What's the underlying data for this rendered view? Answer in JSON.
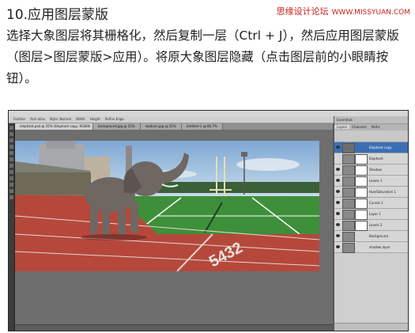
{
  "article": {
    "heading": "10.应用图层蒙版",
    "watermark": "思缘设计论坛",
    "watermark_url": "WWW.MISSYUAN.COM",
    "instructions": "选择大象图层将其栅格化，然后复制一层（Ctrl + J），然后应用图层蒙版（图层>图层蒙版>应用）。将原大象图层隐藏（点击图层前的小眼睛按钮）。"
  },
  "photoshop": {
    "options_bar": [
      "Feather",
      "Anti-alias",
      "Style: Normal",
      "Width",
      "Height",
      "Refine Edge"
    ],
    "document_tabs": [
      {
        "label": "elephant.psd @ 25% (Elephant copy, RGB/8)",
        "active": true
      },
      {
        "label": "background.jpg @ 25%",
        "active": false
      },
      {
        "label": "stadium.jpg @ 25%",
        "active": false
      },
      {
        "label": "Untitled-1 @ 66.7%",
        "active": false
      }
    ],
    "panel": {
      "header": "Essentials",
      "tabs": [
        "Layers",
        "Channels",
        "Paths"
      ],
      "layers": [
        {
          "name": "Elephant copy",
          "selected": true,
          "has_mask": false,
          "visible": true
        },
        {
          "name": "Elephant",
          "selected": false,
          "has_mask": true,
          "visible": false
        },
        {
          "name": "Shadow",
          "selected": false,
          "has_mask": true,
          "visible": true
        },
        {
          "name": "Levels 1",
          "selected": false,
          "has_mask": true,
          "visible": true
        },
        {
          "name": "Hue/Saturation 1",
          "selected": false,
          "has_mask": true,
          "visible": true
        },
        {
          "name": "Curves 1",
          "selected": false,
          "has_mask": true,
          "visible": true
        },
        {
          "name": "Layer 1",
          "selected": false,
          "has_mask": true,
          "visible": true
        },
        {
          "name": "Levels 2",
          "selected": false,
          "has_mask": true,
          "visible": true
        },
        {
          "name": "Background",
          "selected": false,
          "has_mask": false,
          "visible": true
        },
        {
          "name": "shadow layer",
          "selected": false,
          "has_mask": false,
          "visible": true
        }
      ]
    },
    "colors": {
      "accent_selected": "#3b6fb4",
      "track": "#b5483b",
      "field": "#3e8f3a",
      "sky": "#8fb3d6",
      "watermark_red": "#c81e1e"
    }
  }
}
